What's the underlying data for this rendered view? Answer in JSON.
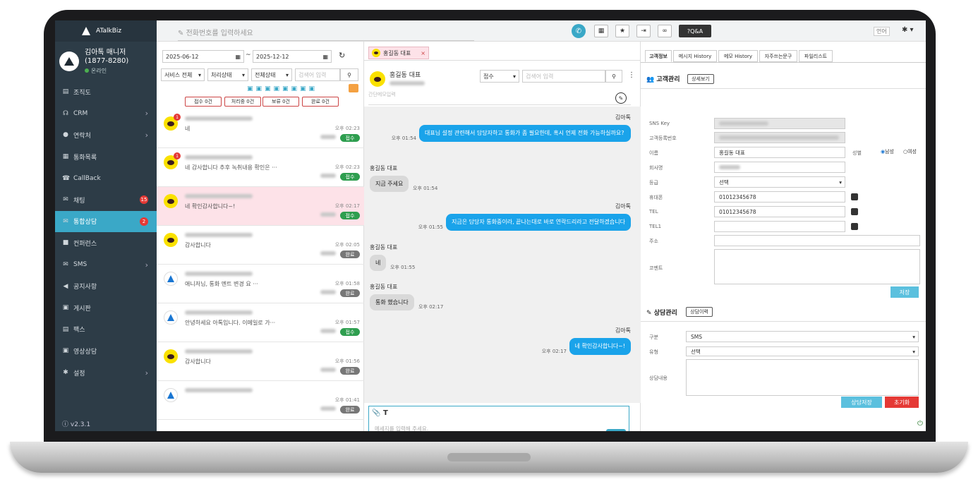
{
  "app": {
    "name": "ATalkBiz",
    "version": "v2.3.1"
  },
  "profile": {
    "name": "김아톡 매니저",
    "phone": "(1877-8280)",
    "status": "온라인"
  },
  "menu": [
    {
      "label": "조직도",
      "icon": "org-icon"
    },
    {
      "label": "CRM",
      "icon": "headset-icon",
      "chevron": "›"
    },
    {
      "label": "연락처",
      "icon": "user-icon",
      "chevron": "›"
    },
    {
      "label": "통화목록",
      "icon": "calllog-icon"
    },
    {
      "label": "CallBack",
      "icon": "callback-icon"
    },
    {
      "label": "채팅",
      "icon": "chat-icon",
      "badge": "15"
    },
    {
      "label": "통합상담",
      "icon": "consult-icon",
      "badge": "2"
    },
    {
      "label": "컨퍼런스",
      "icon": "video-icon"
    },
    {
      "label": "SMS",
      "icon": "sms-icon",
      "chevron": "›"
    },
    {
      "label": "공지사항",
      "icon": "megaphone-icon"
    },
    {
      "label": "게시판",
      "icon": "board-icon"
    },
    {
      "label": "팩스",
      "icon": "fax-icon"
    },
    {
      "label": "영상상담",
      "icon": "camera-icon"
    },
    {
      "label": "설정",
      "icon": "gear-icon",
      "chevron": "›"
    }
  ],
  "topbar": {
    "phone_placeholder": "전화번호를 입력하세요",
    "qa": "Q&A",
    "lang": "언어"
  },
  "filters": {
    "date_from": "2025-06-12",
    "date_to": "2025-12-12",
    "tilde": "~",
    "service": "서비스 전체",
    "process": "처리상태",
    "all": "전체상태",
    "search_placeholder": "검색어 입력",
    "counts": [
      "접수 0건",
      "처리중 0건",
      "보류 0건",
      "완료 0건"
    ]
  },
  "conversations": [
    {
      "type": "kakao",
      "badge": "1",
      "msg": "네",
      "time": "오후 02:23",
      "status": "접수"
    },
    {
      "type": "kakao",
      "badge": "1",
      "msg": "네 감사합니다 추후 녹취내용 확인은 ···",
      "time": "오후 02:23",
      "status": "접수"
    },
    {
      "type": "kakao",
      "msg": "네 확인감사합니다~!",
      "time": "오후 02:17",
      "status": "접수",
      "selected": true
    },
    {
      "type": "kakao",
      "msg": "감사합니다",
      "time": "오후 02:05",
      "status": "완료"
    },
    {
      "type": "atalk",
      "msg": "애니저님, 통화 멘트 변경 요 ···",
      "time": "오후 01:58",
      "status": "완료"
    },
    {
      "type": "atalk",
      "msg": "안녕하세요 아톡입니다. 이메일로 가···",
      "time": "오후 01:57",
      "status": "접수"
    },
    {
      "type": "kakao",
      "msg": "감사합니다",
      "time": "오후 01:56",
      "status": "완료"
    },
    {
      "type": "atalk",
      "msg": "",
      "time": "오후 01:41",
      "status": "완료"
    }
  ],
  "chat": {
    "tab": "홍길동 대표",
    "contact": "홍길동 대표",
    "status_select": "접수",
    "search_placeholder": "검색어 입력",
    "memo_placeholder": "간단메모입력",
    "messages": [
      {
        "dir": "out",
        "sender": "김아톡",
        "text": "대표님 설정 관련해서 담당자하고 통화가 좀 필요한데, 혹시 언제 전화 가능하실까요?",
        "time": "오후 01:54"
      },
      {
        "dir": "in",
        "sender": "홍길동 대표",
        "text": "지금 주세요",
        "time": "오후 01:54"
      },
      {
        "dir": "out",
        "sender": "김아톡",
        "text": "지금은 담당자 통화중이라, 끝나는대로 바로 연락드리라고 전달하겠습니다",
        "time": "오후 01:55"
      },
      {
        "dir": "in",
        "sender": "홍길동 대표",
        "text": "네",
        "time": "오후 01:55"
      },
      {
        "dir": "in",
        "sender": "홍길동 대표",
        "text": "통화 했습니다",
        "time": "오후 02:17"
      },
      {
        "dir": "out",
        "sender": "김아톡",
        "text": "네 확인감사합니다~!",
        "time": "오후 02:17"
      }
    ],
    "input_placeholder": "메세지를 입력해 주세요."
  },
  "info": {
    "tabs": [
      "고객정보",
      "메시지 History",
      "메모 History",
      "자주쓰는문구",
      "파일리스트"
    ],
    "customer_title": "고객관리",
    "detail_btn": "상세보기",
    "fields": {
      "sns_key": "SNS Key",
      "reg_no": "고객등록번호",
      "name_label": "이름",
      "name": "홍길동 대표",
      "gender_label": "성별",
      "male": "남성",
      "female": "여성",
      "company": "회사명",
      "grade": "등급",
      "grade_val": "선택",
      "mobile_label": "휴대폰",
      "mobile": "01012345678",
      "tel_label": "TEL",
      "tel": "01012345678",
      "tel1_label": "TEL1",
      "address": "주소",
      "comment": "코멘트"
    },
    "save": "저장",
    "consult_title": "상담관리",
    "history_btn": "상담이력",
    "consult": {
      "type_label": "구분",
      "type_val": "SMS",
      "kind_label": "유형",
      "kind_val": "선택",
      "content_label": "상담내용"
    },
    "consult_save": "상담저장",
    "reset": "초기화"
  }
}
